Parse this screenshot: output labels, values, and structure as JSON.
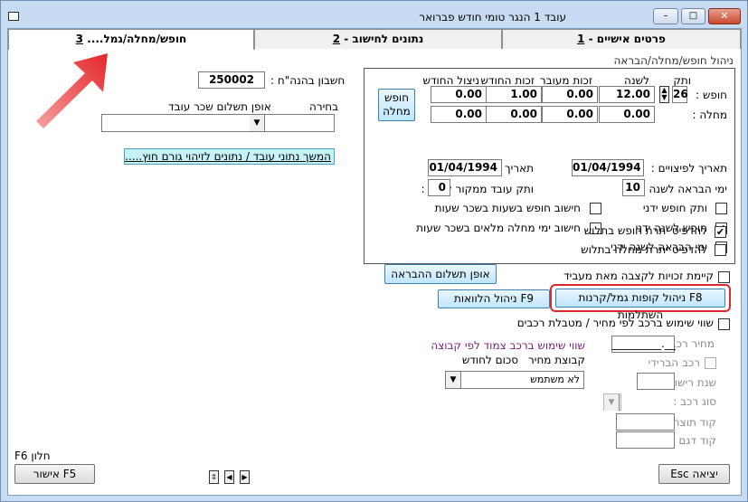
{
  "window": {
    "title": "עובד 1 הנגר טומי    חודש פברואר",
    "controls": {
      "minimize": "–",
      "maximize": "□",
      "close": "✕"
    }
  },
  "tabs": [
    {
      "num": "1",
      "label": "פרטים אישיים - "
    },
    {
      "num": "2",
      "label": "נתונים לחישוב - "
    },
    {
      "num": "3",
      "label": "חופש/מחלה/גמל.... "
    }
  ],
  "leave": {
    "section_title": "ניהול חופש/מחלה/הבראה",
    "cols": [
      "ותק",
      "לשנה",
      "זכות מעובר",
      "זכות החודש",
      "ניצול החודש"
    ],
    "row_vacation": {
      "label": "חופש :",
      "seniority": "26",
      "per_year": "12.00",
      "carried": "0.00",
      "monthly": "1.00",
      "used": "0.00"
    },
    "row_sick": {
      "label": "מחלה :",
      "per_year": "0.00",
      "carried": "0.00",
      "monthly": "0.00",
      "used": "0.00"
    },
    "vacation_sick_btn": "חופש\nמחלה",
    "vacation_sick_btn_l1": "חופש",
    "vacation_sick_btn_l2": "מחלה",
    "severance_date_label": "תאריך לפיצויים :",
    "severance_date": "01/04/1994",
    "seniority_date_label": "תאריך ותק :",
    "seniority_date": "01/04/1994",
    "recovery_days_label": "ימי הבראה לשנה :",
    "recovery_days": "10",
    "prev_seniority_label": "ותק עובד ממקור קודם :",
    "prev_seniority": "0",
    "checks": [
      {
        "label": "ותק חופש ידני",
        "checked": false
      },
      {
        "label": "חופש לשנה ידני",
        "checked": true
      },
      {
        "label": "ימי הבראה לשנה ידני",
        "checked": false
      },
      {
        "label": "להדפיס יתרת חופש בתלוש",
        "checked": true
      },
      {
        "label": "להדפיס יתרת מחלה בתלוש",
        "checked": false
      }
    ],
    "checks_right": [
      {
        "label": "חישוב חופש בשעות בשכר שעות",
        "checked": false
      },
      {
        "label": "חישוב ימי מחלה מלאים בשכר שעות",
        "checked": false
      }
    ],
    "recovery_pay_btn": "אופן תשלום ההבראה"
  },
  "left": {
    "account_label": "חשבון בהנה\"ח :",
    "account_value": "250002",
    "select_label": "בחירה",
    "pay_method_label": "אופן תשלום שכר עובד",
    "continue_bar": "המשך נתוני עובד / נתונים לזיהוי גורם חוץ....."
  },
  "benefits": {
    "transfer_rights_label": "קיימת זכויות לקצבה מאת מעביד",
    "transfer_rights_checked": false,
    "f8_btn": "F8 ניהול קופות גמל/קרנות השתלמות",
    "f9_btn": "F9 ניהול הלוואות"
  },
  "car": {
    "car_value_label": "שווי שימוש ברכב לפי מחיר / מטבלת רכבים",
    "car_value_checked": false,
    "price_label": "מחיר רכב :",
    "price_value": "_________.__",
    "hybrid_label": "רכב הברידי",
    "hybrid_checked": false,
    "reg_year_label": "שנת רישום :",
    "car_type_label": "סוג רכב :",
    "maker_code_label": "קוד תוצר :",
    "model_code_label": "קוד דגם :",
    "group_title": "שווי שימוש ברכב צמוד לפי קבוצה",
    "group_price_label": "קבוצת מחיר",
    "monthly_sum_label": "סכום לחודש",
    "group_select_value": "לא משתמש"
  },
  "footer": {
    "f6_label": "F6 חלון",
    "f5_btn": "F5 אישור",
    "esc_btn": "יציאה Esc",
    "nav": [
      "⇕",
      "◀",
      "▶"
    ]
  },
  "colors": {
    "annotation": "#e3262b",
    "accent": "#c6f2f7",
    "window_frame": "#c7dcf2"
  }
}
